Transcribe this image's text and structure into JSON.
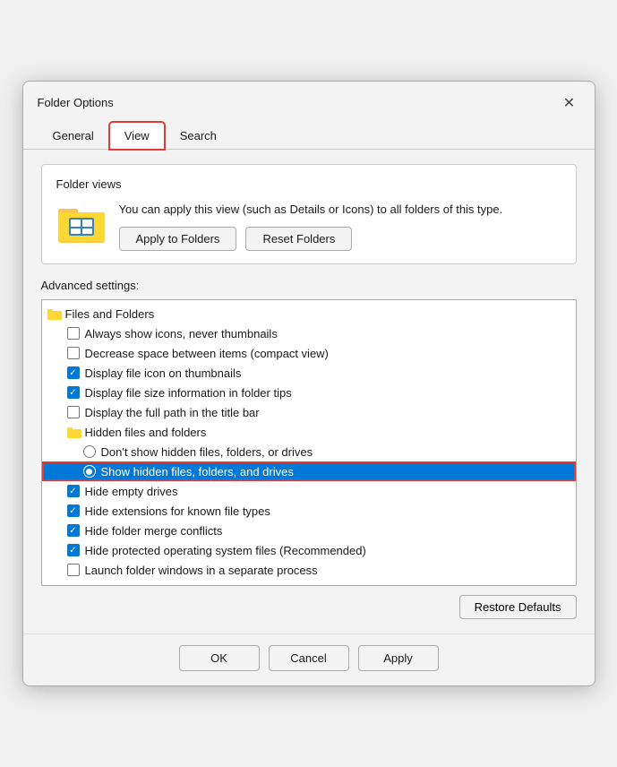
{
  "dialog": {
    "title": "Folder Options",
    "close_label": "✕"
  },
  "tabs": [
    {
      "id": "general",
      "label": "General",
      "active": false,
      "highlighted": false
    },
    {
      "id": "view",
      "label": "View",
      "active": true,
      "highlighted": true
    },
    {
      "id": "search",
      "label": "Search",
      "active": false,
      "highlighted": false
    }
  ],
  "folder_views": {
    "section_label": "Folder views",
    "description": "You can apply this view (such as Details or Icons) to all folders of this type.",
    "apply_btn": "Apply to Folders",
    "reset_btn": "Reset Folders"
  },
  "advanced": {
    "label": "Advanced settings:",
    "restore_btn": "Restore Defaults",
    "items": [
      {
        "type": "group",
        "icon": "folder",
        "label": "Files and Folders",
        "level": 0
      },
      {
        "type": "checkbox",
        "checked": false,
        "label": "Always show icons, never thumbnails",
        "level": 1
      },
      {
        "type": "checkbox",
        "checked": false,
        "label": "Decrease space between items (compact view)",
        "level": 1
      },
      {
        "type": "checkbox",
        "checked": true,
        "label": "Display file icon on thumbnails",
        "level": 1
      },
      {
        "type": "checkbox",
        "checked": true,
        "label": "Display file size information in folder tips",
        "level": 1
      },
      {
        "type": "checkbox",
        "checked": false,
        "label": "Display the full path in the title bar",
        "level": 1
      },
      {
        "type": "group",
        "icon": "folder-small",
        "label": "Hidden files and folders",
        "level": 1
      },
      {
        "type": "radio",
        "checked": false,
        "label": "Don't show hidden files, folders, or drives",
        "level": 2
      },
      {
        "type": "radio",
        "checked": true,
        "label": "Show hidden files, folders, and drives",
        "level": 2,
        "selected": true
      },
      {
        "type": "checkbox",
        "checked": true,
        "label": "Hide empty drives",
        "level": 1
      },
      {
        "type": "checkbox",
        "checked": true,
        "label": "Hide extensions for known file types",
        "level": 1
      },
      {
        "type": "checkbox",
        "checked": true,
        "label": "Hide folder merge conflicts",
        "level": 1
      },
      {
        "type": "checkbox",
        "checked": true,
        "label": "Hide protected operating system files (Recommended)",
        "level": 1
      },
      {
        "type": "checkbox",
        "checked": false,
        "label": "Launch folder windows in a separate process",
        "level": 1
      }
    ]
  },
  "action_buttons": {
    "ok": "OK",
    "cancel": "Cancel",
    "apply": "Apply"
  }
}
